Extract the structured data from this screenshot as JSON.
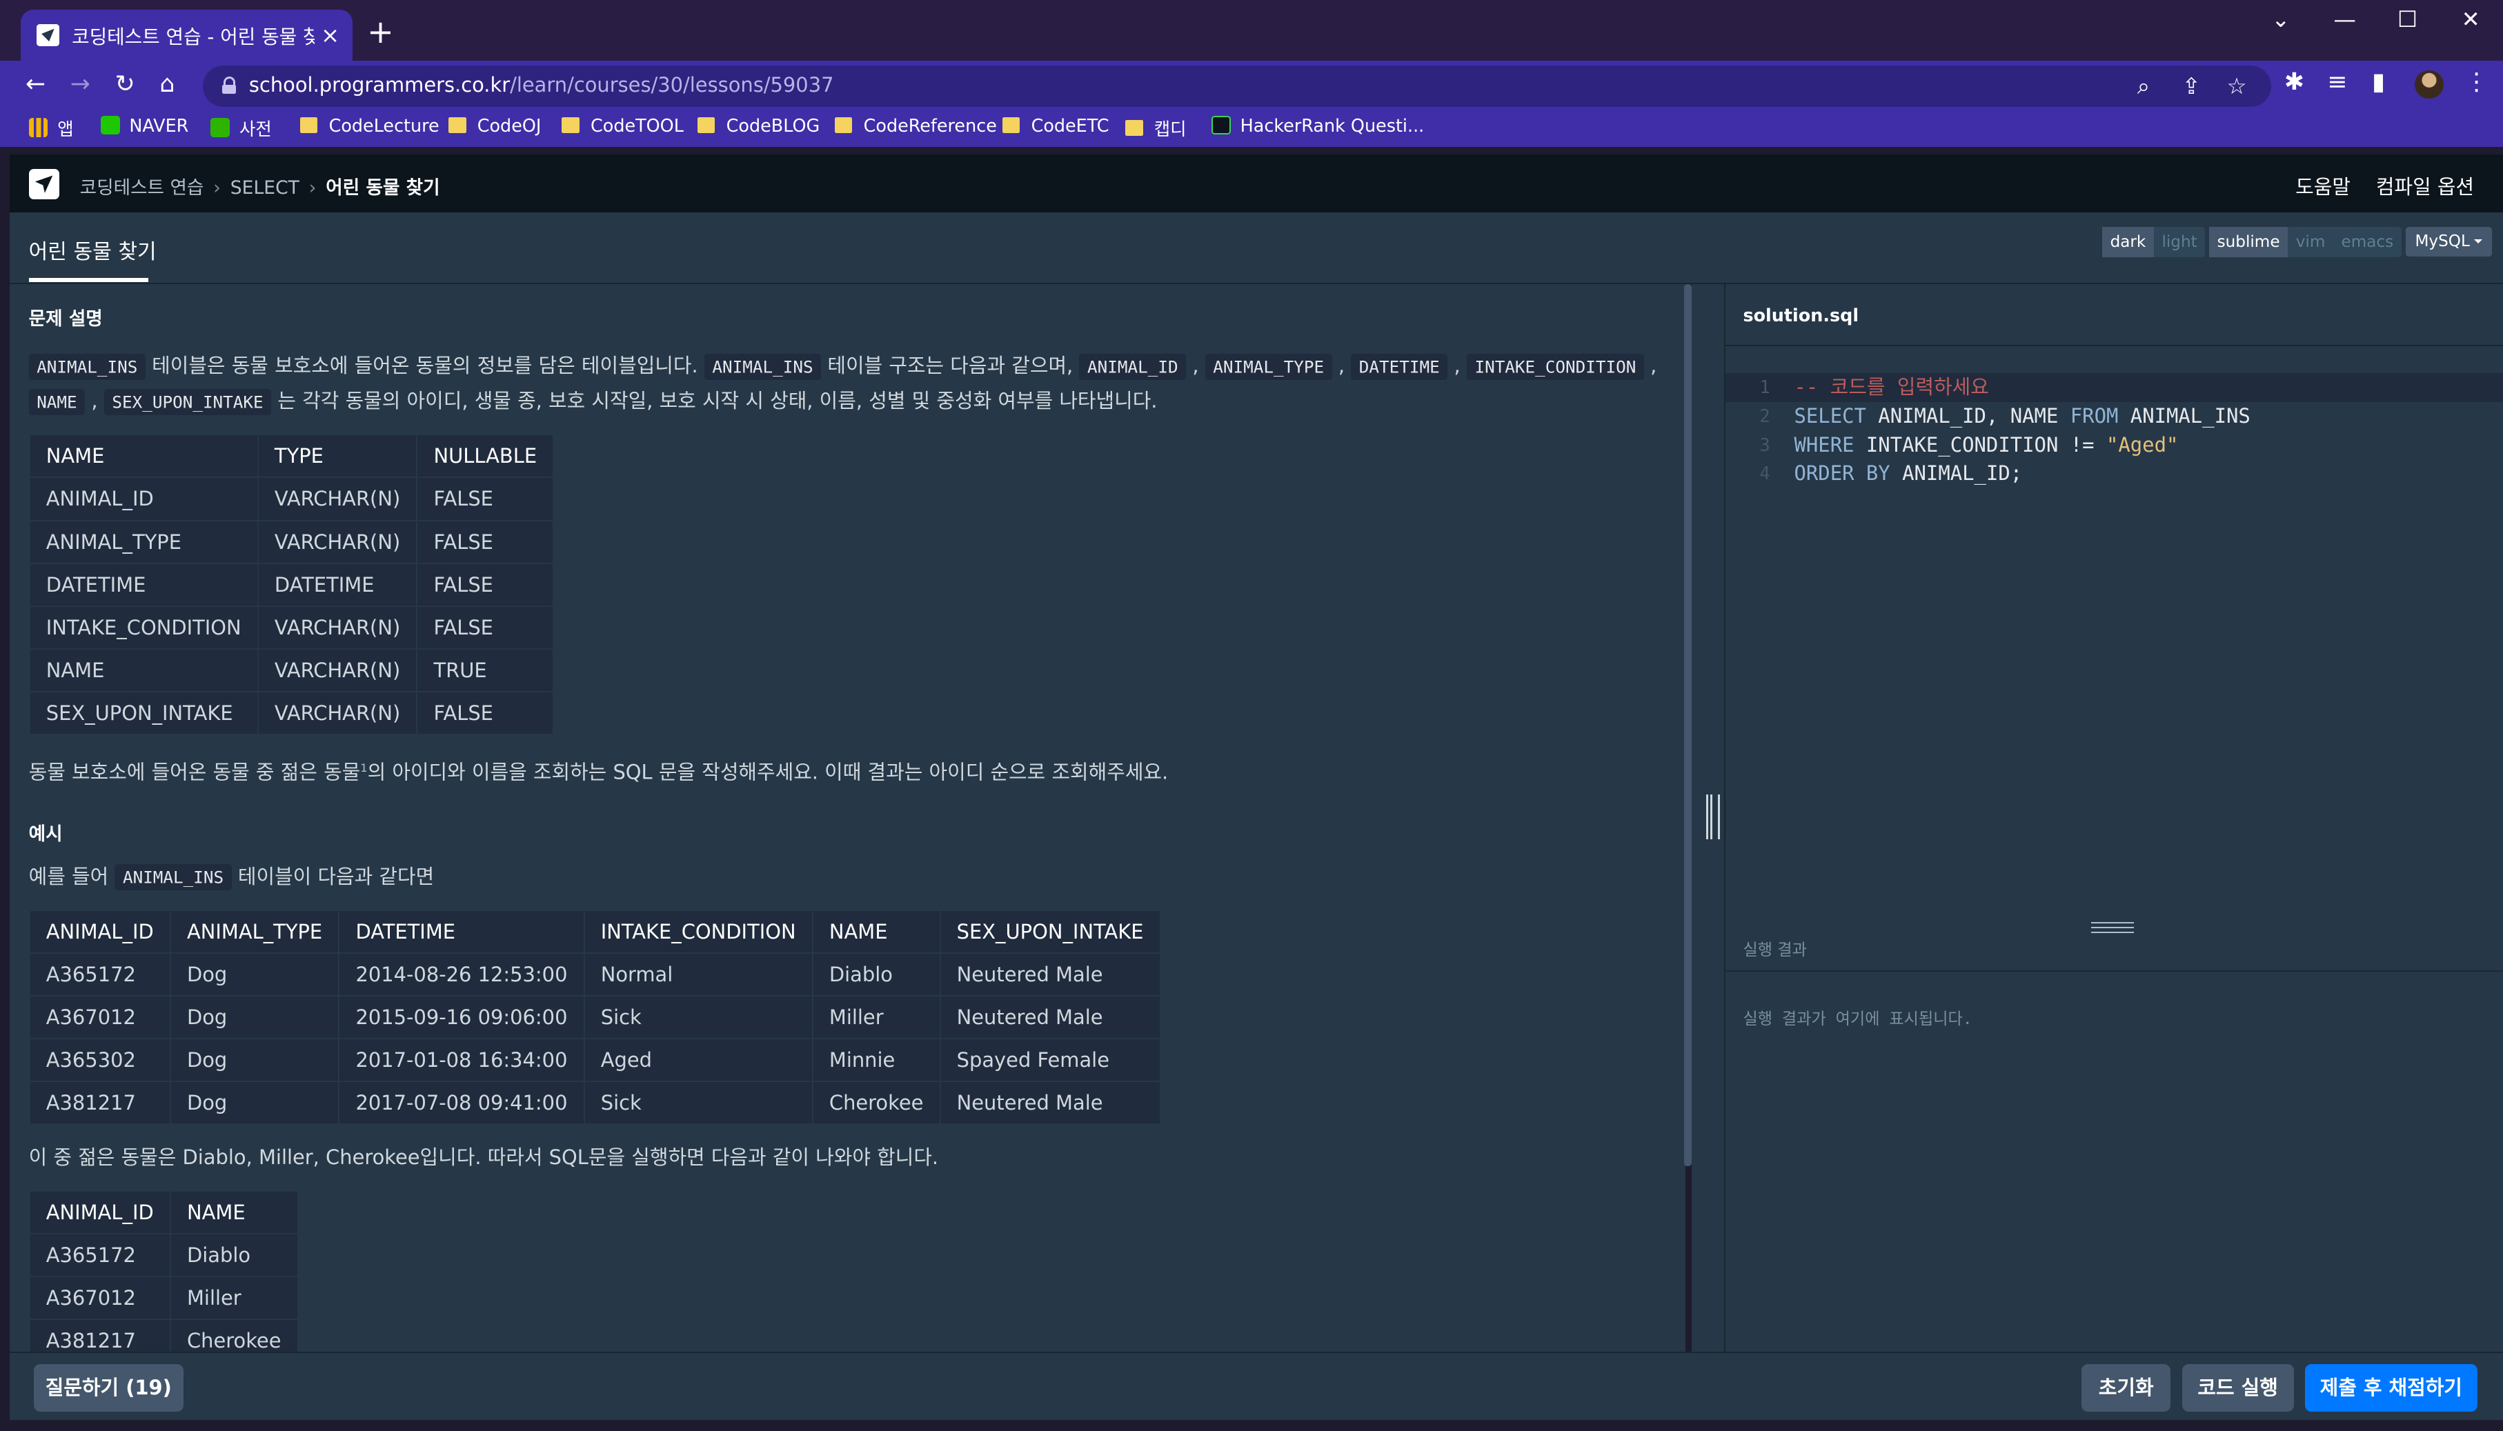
{
  "browser": {
    "tab_title": "코딩테스트 연습 - 어린 동물 찾",
    "tab_close": "×",
    "new_tab": "+",
    "win_min": "—",
    "win_max": "☐",
    "win_close": "✕",
    "win_dropdown": "⌄",
    "url_host": "school.programmers.co.kr",
    "url_path": "/learn/courses/30/lessons/59037",
    "bookmarks": [
      {
        "label": "앱",
        "icon": "apps-grid-icon"
      },
      {
        "label": "NAVER",
        "icon": "naver-icon"
      },
      {
        "label": "사전",
        "icon": "dictionary-icon"
      },
      {
        "label": "CodeLecture",
        "icon": "folder-icon"
      },
      {
        "label": "CodeOJ",
        "icon": "folder-icon"
      },
      {
        "label": "CodeTOOL",
        "icon": "folder-icon"
      },
      {
        "label": "CodeBLOG",
        "icon": "folder-icon"
      },
      {
        "label": "CodeReference",
        "icon": "folder-icon"
      },
      {
        "label": "CodeETC",
        "icon": "folder-icon"
      },
      {
        "label": "캡디",
        "icon": "folder-icon"
      },
      {
        "label": "HackerRank Questi...",
        "icon": "hackerrank-icon"
      }
    ]
  },
  "header": {
    "crumb1": "코딩테스트 연습",
    "crumb2": "SELECT",
    "crumb3": "어린 동물 찾기",
    "help": "도움말",
    "compile_options": "컴파일 옵션"
  },
  "subbar": {
    "lesson_tab": "어린 동물 찾기",
    "theme_dark": "dark",
    "theme_light": "light",
    "key_sublime": "sublime",
    "key_vim": "vim",
    "key_emacs": "emacs",
    "language": "MySQL"
  },
  "problem": {
    "section_desc": "문제 설명",
    "desc_line1": {
      "c1": "ANIMAL_INS",
      "t1": " 테이블은 동물 보호소에 들어온 동물의 정보를 담은 테이블입니다. ",
      "c2": "ANIMAL_INS",
      "t2": " 테이블 구조는 다음과 같으며, ",
      "c3": "ANIMAL_ID",
      "t3": " , ",
      "c4": "ANIMAL_TYPE",
      "t4": " , ",
      "c5": "DATETIME",
      "t5": " , ",
      "c6": "INTAKE_CONDITION",
      "t6": " ,"
    },
    "desc_line2": {
      "c1": "NAME",
      "t1": " , ",
      "c2": "SEX_UPON_INTAKE",
      "t2": " 는 각각 동물의 아이디, 생물 종, 보호 시작일, 보호 시작 시 상태, 이름, 성별 및 중성화 여부를 나타냅니다."
    },
    "schema_headers": [
      "NAME",
      "TYPE",
      "NULLABLE"
    ],
    "schema_rows": [
      [
        "ANIMAL_ID",
        "VARCHAR(N)",
        "FALSE"
      ],
      [
        "ANIMAL_TYPE",
        "VARCHAR(N)",
        "FALSE"
      ],
      [
        "DATETIME",
        "DATETIME",
        "FALSE"
      ],
      [
        "INTAKE_CONDITION",
        "VARCHAR(N)",
        "FALSE"
      ],
      [
        "NAME",
        "VARCHAR(N)",
        "TRUE"
      ],
      [
        "SEX_UPON_INTAKE",
        "VARCHAR(N)",
        "FALSE"
      ]
    ],
    "task_before": "동물 보호소에 들어온 동물 중 젊은 동물",
    "task_sup": "1",
    "task_after": "의 아이디와 이름을 조회하는 SQL 문을 작성해주세요. 이때 결과는 아이디 순으로 조회해주세요.",
    "section_example": "예시",
    "example_intro_before": "예를 들어 ",
    "example_intro_code": "ANIMAL_INS",
    "example_intro_after": " 테이블이 다음과 같다면",
    "example_headers": [
      "ANIMAL_ID",
      "ANIMAL_TYPE",
      "DATETIME",
      "INTAKE_CONDITION",
      "NAME",
      "SEX_UPON_INTAKE"
    ],
    "example_rows": [
      [
        "A365172",
        "Dog",
        "2014-08-26 12:53:00",
        "Normal",
        "Diablo",
        "Neutered Male"
      ],
      [
        "A367012",
        "Dog",
        "2015-09-16 09:06:00",
        "Sick",
        "Miller",
        "Neutered Male"
      ],
      [
        "A365302",
        "Dog",
        "2017-01-08 16:34:00",
        "Aged",
        "Minnie",
        "Spayed Female"
      ],
      [
        "A381217",
        "Dog",
        "2017-07-08 09:41:00",
        "Sick",
        "Cherokee",
        "Neutered Male"
      ]
    ],
    "result_intro": "이 중 젊은 동물은 Diablo, Miller, Cherokee입니다. 따라서 SQL문을 실행하면 다음과 같이 나와야 합니다.",
    "result_headers": [
      "ANIMAL_ID",
      "NAME"
    ],
    "result_rows": [
      [
        "A365172",
        "Diablo"
      ],
      [
        "A367012",
        "Miller"
      ],
      [
        "A381217",
        "Cherokee"
      ]
    ]
  },
  "editor": {
    "filename": "solution.sql",
    "lines": [
      {
        "n": "1",
        "parts": [
          [
            "cm",
            "-- 코드를 입력하세요"
          ]
        ]
      },
      {
        "n": "2",
        "parts": [
          [
            "kw",
            "SELECT"
          ],
          [
            "",
            " ANIMAL_ID, NAME "
          ],
          [
            "kw",
            "FROM"
          ],
          [
            "",
            " ANIMAL_INS"
          ]
        ]
      },
      {
        "n": "3",
        "parts": [
          [
            "kw",
            "WHERE"
          ],
          [
            "",
            " INTAKE_CONDITION != "
          ],
          [
            "str",
            "\"Aged\""
          ]
        ]
      },
      {
        "n": "4",
        "parts": [
          [
            "kw",
            "ORDER BY"
          ],
          [
            "",
            " ANIMAL_ID;"
          ]
        ]
      }
    ],
    "result_label": "실행 결과",
    "result_placeholder": "실행 결과가 여기에 표시됩니다."
  },
  "footer": {
    "ask": "질문하기 (19)",
    "reset": "초기화",
    "run": "코드 실행",
    "submit": "제출 후 채점하기"
  },
  "colors": {
    "browser_frame": "#3f2ea8",
    "panel": "#263747",
    "header": "#0c151c",
    "submit_blue": "#0078ff"
  }
}
